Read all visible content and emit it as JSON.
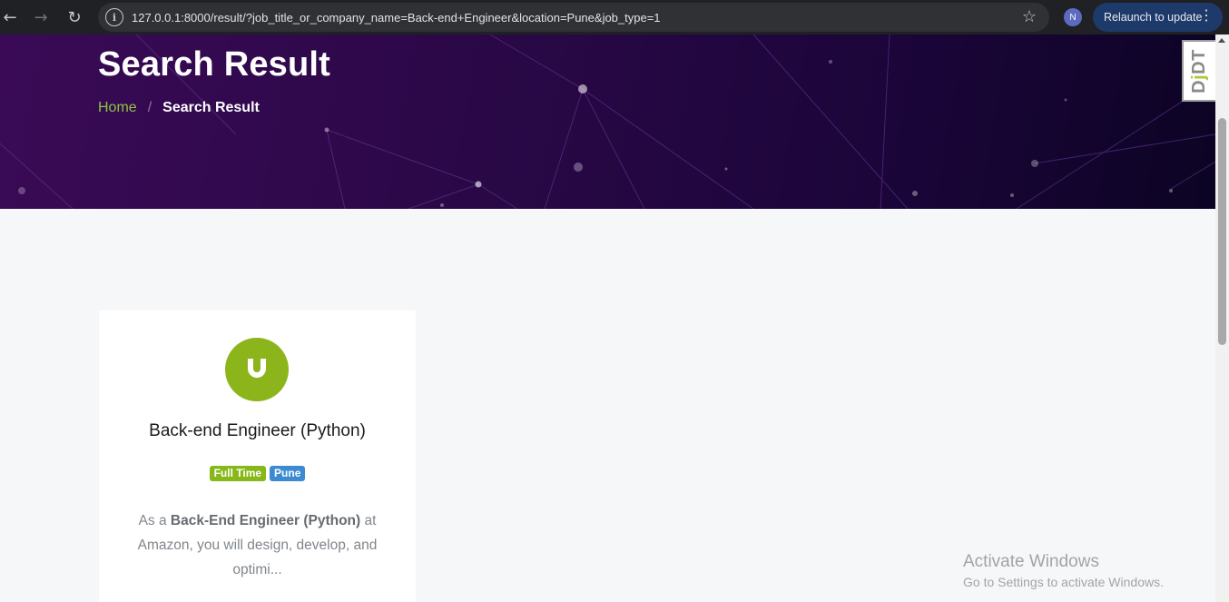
{
  "browser": {
    "url_host": "127.0.0.1",
    "url_rest": ":8000/result/?job_title_or_company_name=Back-end+Engineer&location=Pune&job_type=1",
    "profile_initial": "N",
    "relaunch_label": "Relaunch to update"
  },
  "hero": {
    "title": "Search Result",
    "breadcrumb": {
      "home": "Home",
      "separator": "/",
      "current": "Search Result"
    }
  },
  "job": {
    "title": "Back-end Engineer (Python)",
    "job_type": "Full Time",
    "location": "Pune",
    "desc_prefix": "As a ",
    "desc_bold": "Back-End Engineer (Python)",
    "desc_suffix": " at Amazon, you will design, develop, and optimi..."
  },
  "debug_toolbar": {
    "label_d": "D",
    "label_j": "j",
    "label_dt": "DT"
  },
  "watermark": {
    "title": "Activate Windows",
    "subtitle": "Go to Settings to activate Windows."
  },
  "colors": {
    "hero_bg": "#2a0847",
    "accent_green": "#8bb51b",
    "badge_blue": "#3c8bd2",
    "relaunch_bg": "#1d3a6b"
  }
}
